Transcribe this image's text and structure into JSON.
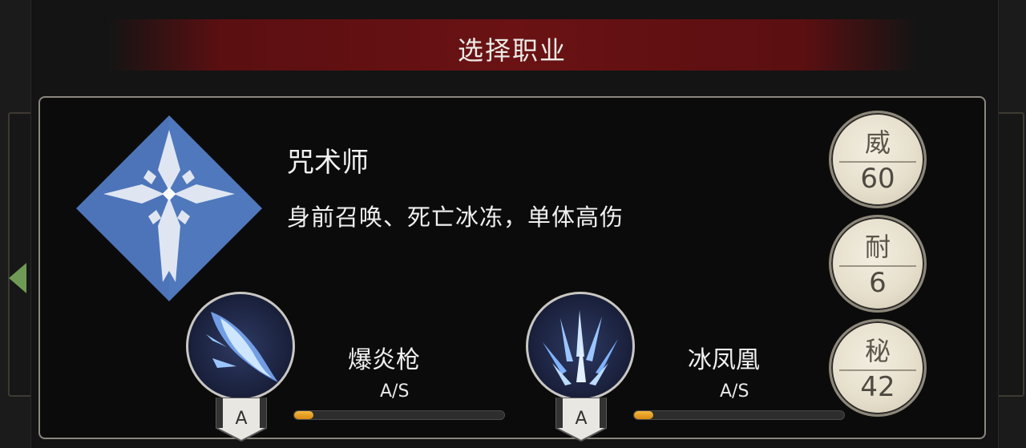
{
  "header": {
    "title": "选择职业"
  },
  "class": {
    "name": "咒术师",
    "description": "身前召唤、死亡冰冻，单体高伤",
    "emblem_color": "#4a72b8"
  },
  "stats": [
    {
      "label": "威",
      "value": "60"
    },
    {
      "label": "耐",
      "value": "6"
    },
    {
      "label": "秘",
      "value": "42"
    }
  ],
  "skills": [
    {
      "name": "爆炎枪",
      "rank": "A/S",
      "grade": "A",
      "progress": 0.09
    },
    {
      "name": "冰凤凰",
      "rank": "A/S",
      "grade": "A",
      "progress": 0.09
    }
  ],
  "colors": {
    "title_band": "#6a1214",
    "badge_fill": "#e6dfcc",
    "progress_fill": "#f0a52c",
    "nav_arrow": "#6f9a55"
  },
  "icons": {
    "prev": "arrow-left-icon",
    "emblem": "snowflake-cross-icon"
  }
}
